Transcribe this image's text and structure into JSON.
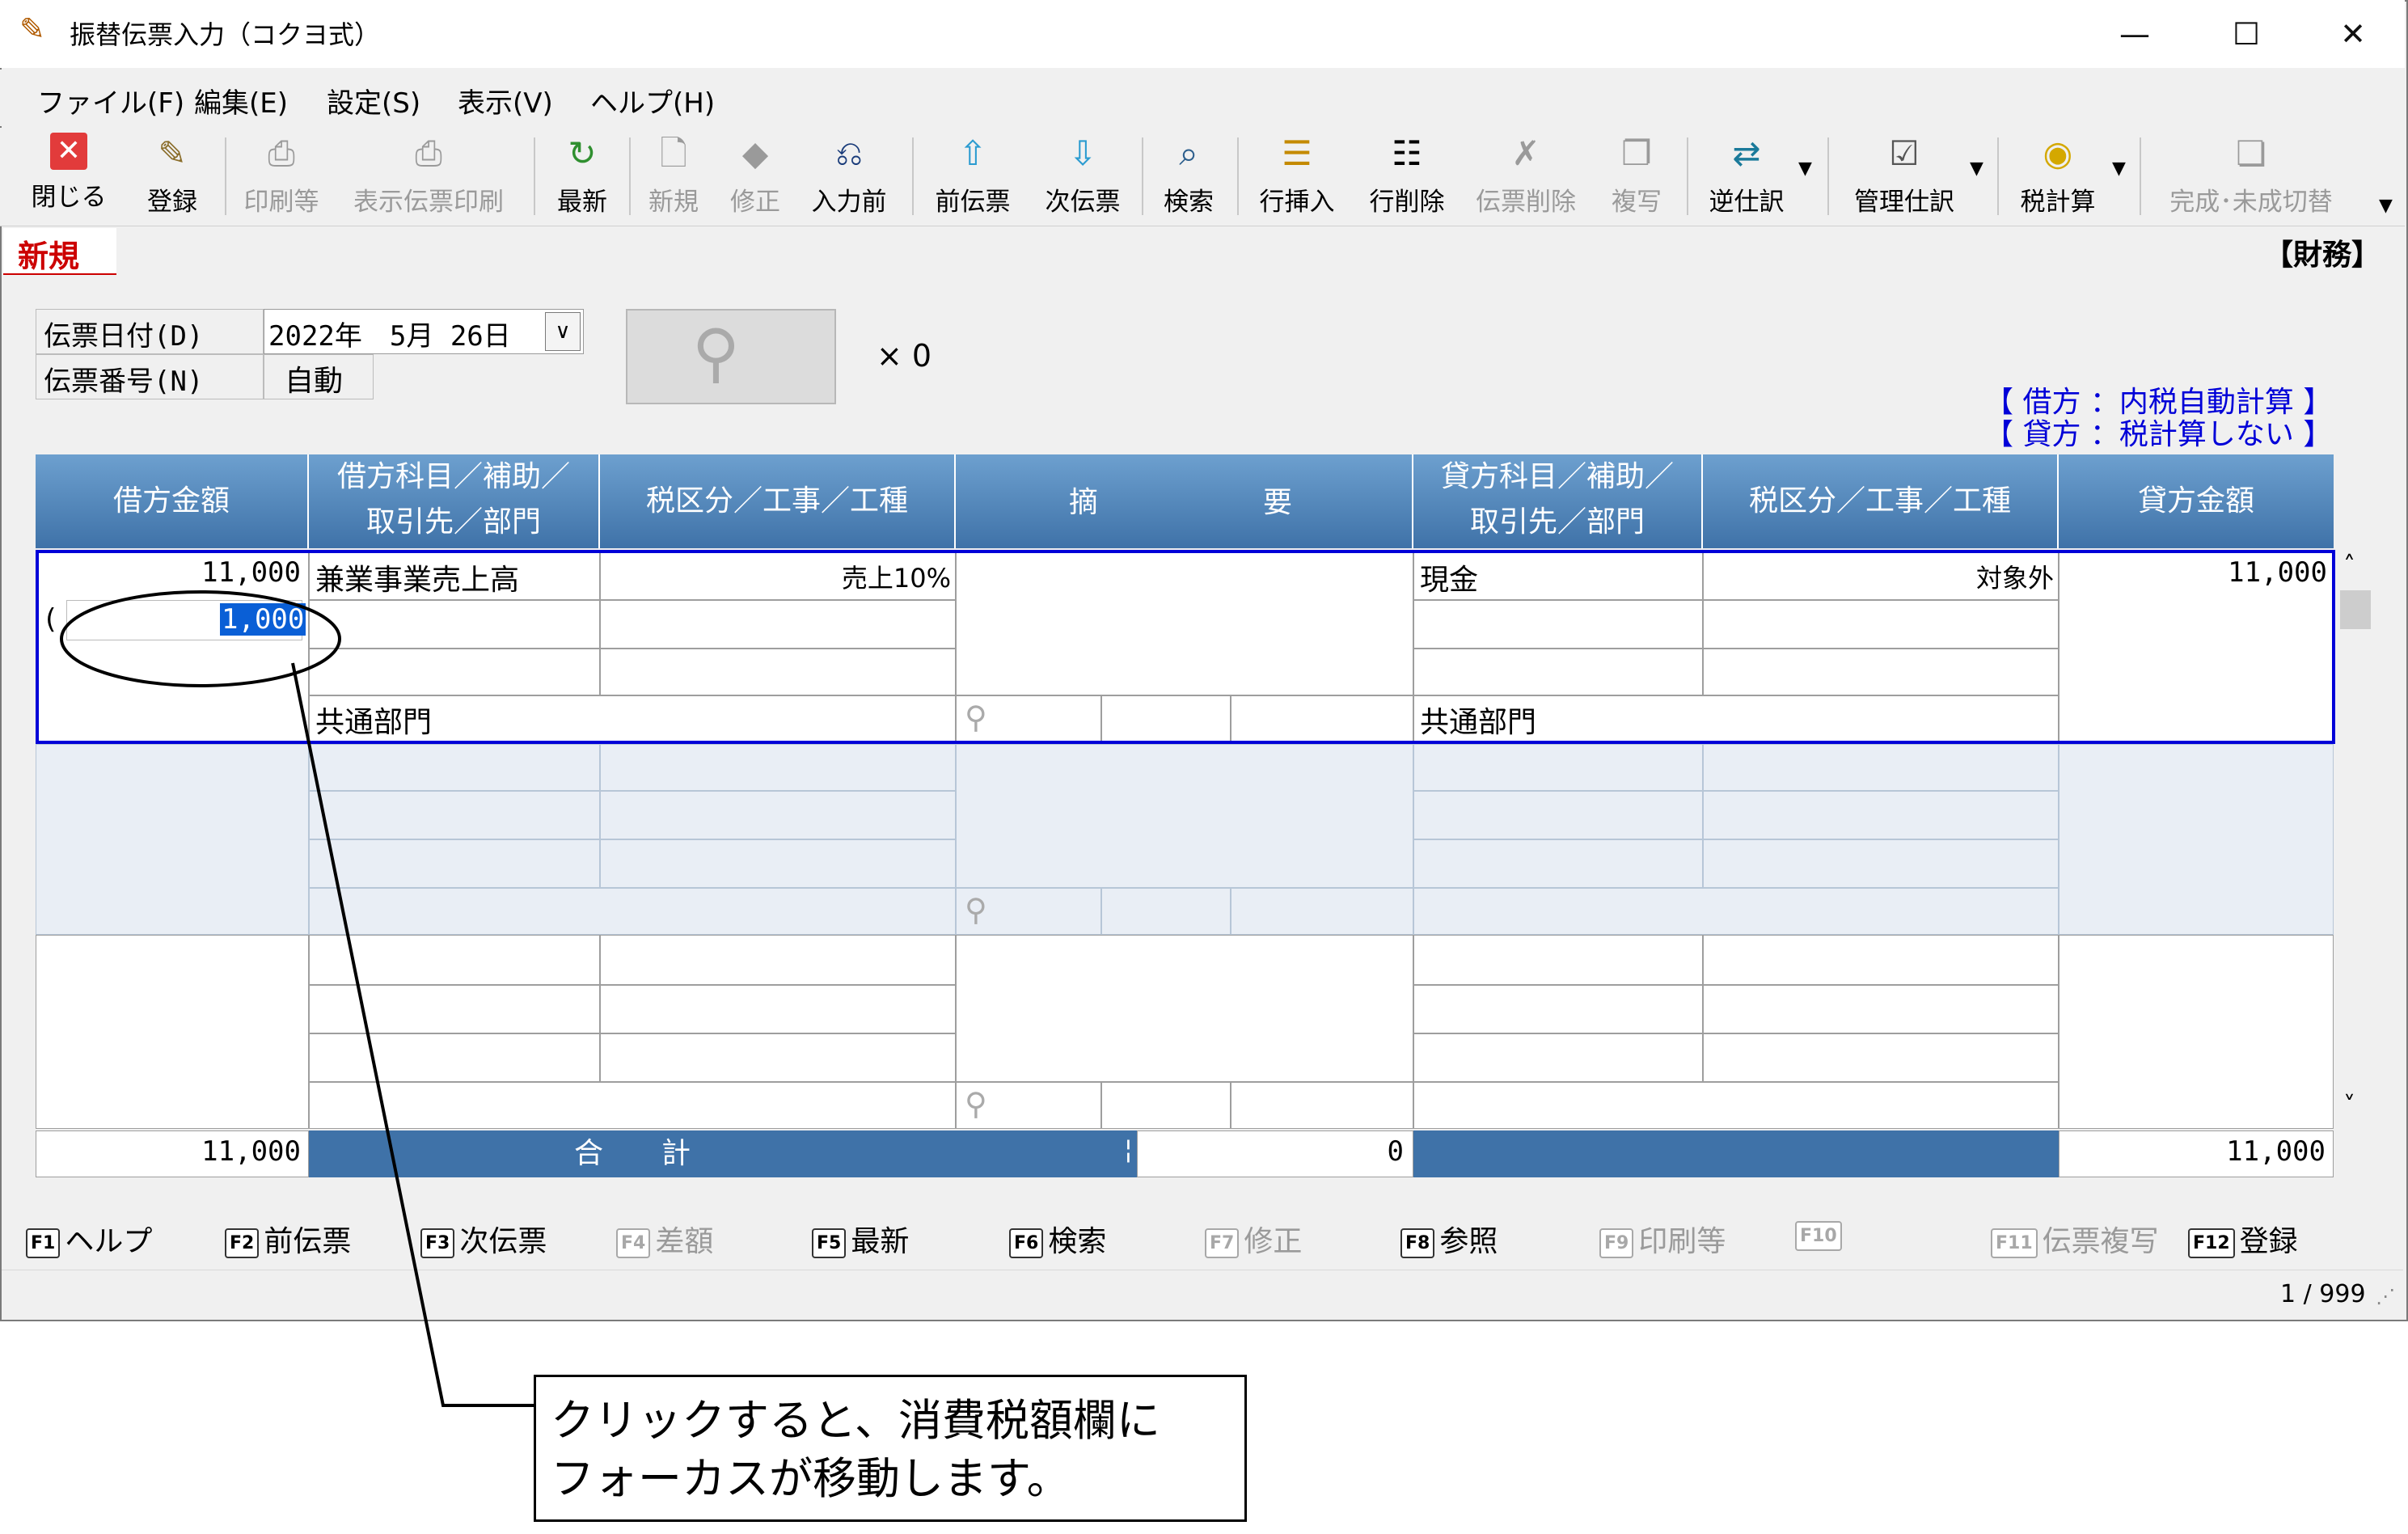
{
  "window": {
    "title": "振替伝票入力（コクヨ式）",
    "minimize": "—",
    "maximize": "☐",
    "close": "✕"
  },
  "menu": [
    "ファイル(F)",
    "編集(E)",
    "設定(S)",
    "表示(V)",
    "ヘルプ(H)"
  ],
  "toolbar": [
    {
      "label": "閉じる",
      "icon": "close-icon",
      "enabled": true
    },
    {
      "label": "登録",
      "icon": "register-icon",
      "enabled": true
    },
    {
      "label": "印刷等",
      "icon": "printer-icon",
      "enabled": false
    },
    {
      "label": "表示伝票印刷",
      "icon": "printer-icon",
      "enabled": false
    },
    {
      "label": "最新",
      "icon": "refresh-icon",
      "enabled": true
    },
    {
      "label": "新規",
      "icon": "new-document-icon",
      "enabled": false
    },
    {
      "label": "修正",
      "icon": "eraser-icon",
      "enabled": false
    },
    {
      "label": "入力前",
      "icon": "undo-document-icon",
      "enabled": true
    },
    {
      "label": "前伝票",
      "icon": "up-arrow-icon",
      "enabled": true
    },
    {
      "label": "次伝票",
      "icon": "down-arrow-icon",
      "enabled": true
    },
    {
      "label": "検索",
      "icon": "magnifier-icon",
      "enabled": true
    },
    {
      "label": "行挿入",
      "icon": "insert-row-icon",
      "enabled": true
    },
    {
      "label": "行削除",
      "icon": "delete-row-icon",
      "enabled": true
    },
    {
      "label": "伝票削除",
      "icon": "delete-document-icon",
      "enabled": false
    },
    {
      "label": "複写",
      "icon": "copy-icon",
      "enabled": false
    },
    {
      "label": "逆仕訳",
      "icon": "reverse-entry-icon",
      "enabled": true
    },
    {
      "label": "管理仕訳",
      "icon": "checklist-icon",
      "enabled": true
    },
    {
      "label": "税計算",
      "icon": "tax-calc-icon",
      "enabled": true
    },
    {
      "label": "完成･未成切替",
      "icon": "toggle-complete-icon",
      "enabled": false
    }
  ],
  "mode_label": "新規",
  "ledger_label": "【財務】",
  "form": {
    "date_label": "伝票日付(D)",
    "date_value": "2022年　5月 26日",
    "number_label": "伝票番号(N)",
    "number_value": "自動",
    "attachment_count": "× 0"
  },
  "tax_notes": [
    "【 借方 ：内税自動計算 】",
    "【 貸方 ：税計算しない 】"
  ],
  "grid": {
    "headers": {
      "debit_amount": "借方金額",
      "debit_account_1": "借方科目／補助／",
      "debit_account_2": "取引先／部門",
      "debit_tax": "税区分／工事／工種",
      "summary_1": "摘",
      "summary_2": "要",
      "credit_account_1": "貸方科目／補助／",
      "credit_account_2": "取引先／部門",
      "credit_tax": "税区分／工事／工種",
      "credit_amount": "貸方金額"
    },
    "row1": {
      "debit_amount": "11,000",
      "tax_paren": "(",
      "tax_amount": "1,000",
      "debit_account": "兼業事業売上高",
      "debit_tax": "売上10%",
      "debit_dept": "共通部門",
      "credit_account": "現金",
      "credit_tax": "対象外",
      "credit_amount": "11,000",
      "credit_dept": "共通部門"
    },
    "total": {
      "debit_total": "11,000",
      "label": "合　　計",
      "mid_mark": "¦",
      "diff": "0",
      "credit_total": "11,000"
    }
  },
  "fkeys": [
    {
      "key": "F1",
      "label": "ヘルプ",
      "enabled": true
    },
    {
      "key": "F2",
      "label": "前伝票",
      "enabled": true
    },
    {
      "key": "F3",
      "label": "次伝票",
      "enabled": true
    },
    {
      "key": "F4",
      "label": "差額",
      "enabled": false
    },
    {
      "key": "F5",
      "label": "最新",
      "enabled": true
    },
    {
      "key": "F6",
      "label": "検索",
      "enabled": true
    },
    {
      "key": "F7",
      "label": "修正",
      "enabled": false
    },
    {
      "key": "F8",
      "label": "参照",
      "enabled": true
    },
    {
      "key": "F9",
      "label": "印刷等",
      "enabled": false
    },
    {
      "key": "F10",
      "label": "",
      "enabled": false
    },
    {
      "key": "F11",
      "label": "伝票複写",
      "enabled": false
    },
    {
      "key": "F12",
      "label": "登録",
      "enabled": true
    }
  ],
  "status": {
    "page": "1 / 999"
  },
  "callout": {
    "line1": "クリックすると、消費税額欄に",
    "line2": "フォーカスが移動します。"
  },
  "colors": {
    "header_blue": "#4f83b8",
    "selection_blue": "#0000d8",
    "mode_red": "#cc0000",
    "note_blue": "#0000d8"
  }
}
